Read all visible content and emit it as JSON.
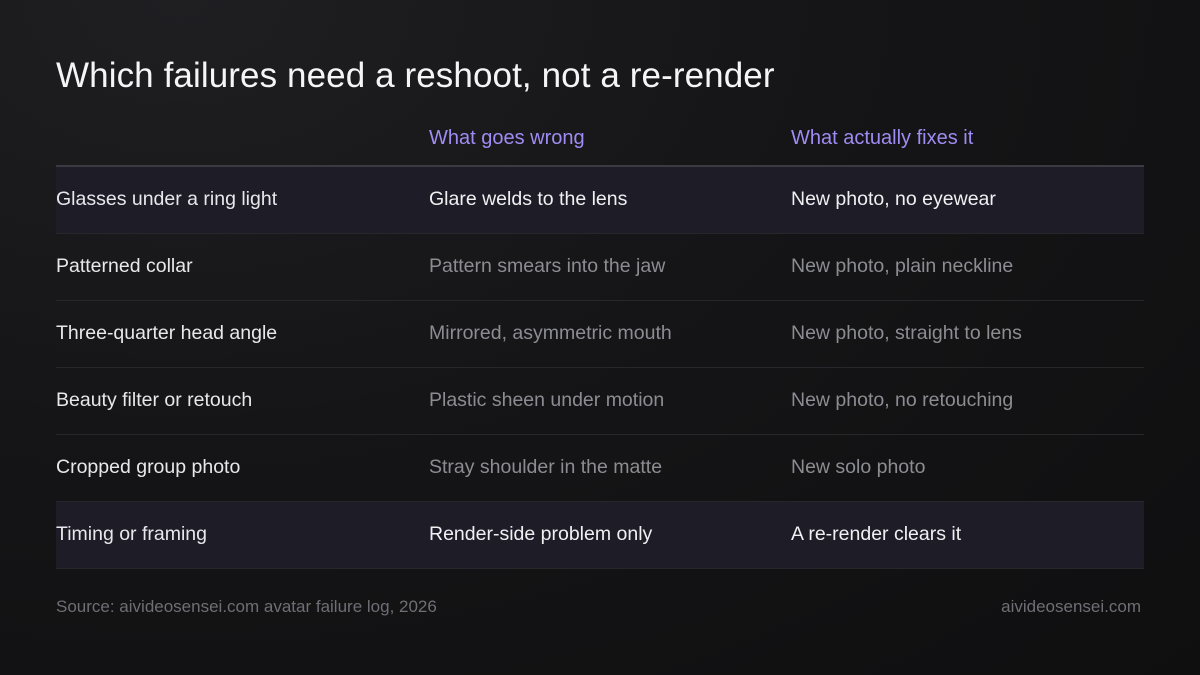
{
  "title": "Which failures need a reshoot, not a re-render",
  "table": {
    "headers": [
      "",
      "What goes wrong",
      "What actually fixes it"
    ],
    "rows": [
      {
        "failure": "Glasses under a ring light",
        "wrong": "Glare welds to the lens",
        "fix": "New photo, no eyewear"
      },
      {
        "failure": "Patterned collar",
        "wrong": "Pattern smears into the jaw",
        "fix": "New photo, plain neckline"
      },
      {
        "failure": "Three-quarter head angle",
        "wrong": "Mirrored, asymmetric mouth",
        "fix": "New photo, straight to lens"
      },
      {
        "failure": "Beauty filter or retouch",
        "wrong": "Plastic sheen under motion",
        "fix": "New photo, no retouching"
      },
      {
        "failure": "Cropped group photo",
        "wrong": "Stray shoulder in the matte",
        "fix": "New solo photo"
      },
      {
        "failure": "Timing or framing",
        "wrong": "Render-side problem only",
        "fix": "A re-render clears it"
      }
    ]
  },
  "footer": {
    "source": "Source: aivideosensei.com avatar failure log, 2026",
    "site": "aivideosensei.com"
  },
  "colors": {
    "accent": "#9f8cf2",
    "background": "#151517",
    "highlight_row": "#1d1c27"
  }
}
